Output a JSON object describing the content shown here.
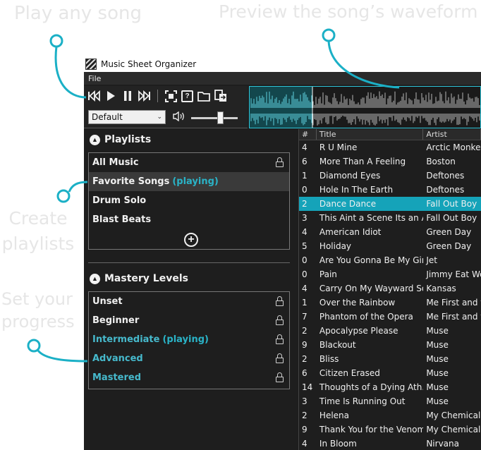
{
  "callouts": {
    "play": "Play any song",
    "preview": "Preview the song’s waveform",
    "create_line1": "Create",
    "create_line2": "playlists",
    "progress_line1": "Set your",
    "progress_line2": "progress"
  },
  "window": {
    "title": "Music Sheet Organizer",
    "menu": [
      "File"
    ]
  },
  "toolbar": {
    "buttons": [
      "previous-icon",
      "play-icon",
      "pause-icon",
      "next-icon",
      "focus-icon",
      "help-icon",
      "folder-icon",
      "export-icon"
    ],
    "mode_value": "Default",
    "volume_level": 0.62
  },
  "waveform": {
    "played_fraction": 0.27
  },
  "playlists": {
    "header": "Playlists",
    "items": [
      {
        "label": "All Music",
        "playing": "",
        "locked": true
      },
      {
        "label": "Favorite Songs",
        "playing": "(playing)",
        "locked": false
      },
      {
        "label": "Drum Solo",
        "playing": "",
        "locked": false
      },
      {
        "label": "Blast Beats",
        "playing": "",
        "locked": false
      }
    ]
  },
  "mastery": {
    "header": "Mastery Levels",
    "items": [
      {
        "label": "Unset",
        "playing": "",
        "locked": true
      },
      {
        "label": "Beginner",
        "playing": "",
        "locked": true
      },
      {
        "label": "Intermediate",
        "playing": "(playing)",
        "locked": true
      },
      {
        "label": "Advanced",
        "playing": "",
        "locked": true
      },
      {
        "label": "Mastered",
        "playing": "",
        "locked": true
      }
    ]
  },
  "songs": {
    "columns": [
      "#",
      "Title",
      "Artist"
    ],
    "rows": [
      [
        "4",
        "R U Mine",
        "Arctic Monkeys"
      ],
      [
        "6",
        "More Than A Feeling",
        "Boston"
      ],
      [
        "1",
        "Diamond Eyes",
        "Deftones"
      ],
      [
        "0",
        "Hole In The Earth",
        "Deftones"
      ],
      [
        "2",
        "Dance Dance",
        "Fall Out Boy"
      ],
      [
        "3",
        "This Aint a Scene Its an A...",
        "Fall Out Boy"
      ],
      [
        "4",
        "American Idiot",
        "Green Day"
      ],
      [
        "5",
        "Holiday",
        "Green Day"
      ],
      [
        "0",
        "Are You Gonna Be My Girl",
        "Jet"
      ],
      [
        "0",
        "Pain",
        "Jimmy Eat World"
      ],
      [
        "4",
        "Carry On My Wayward Son",
        "Kansas"
      ],
      [
        "1",
        "Over the Rainbow",
        "Me First and the"
      ],
      [
        "7",
        "Phantom of the Opera",
        "Me First and the"
      ],
      [
        "2",
        "Apocalypse Please",
        "Muse"
      ],
      [
        "9",
        "Blackout",
        "Muse"
      ],
      [
        "2",
        "Bliss",
        "Muse"
      ],
      [
        "6",
        "Citizen Erased",
        "Muse"
      ],
      [
        "14",
        "Thoughts of a Dying Ath...",
        "Muse"
      ],
      [
        "3",
        "Time Is Running Out",
        "Muse"
      ],
      [
        "2",
        "Helena",
        "My Chemical Romance"
      ],
      [
        "9",
        "Thank You for the Venom",
        "My Chemical Romance"
      ],
      [
        "4",
        "In Bloom",
        "Nirvana"
      ]
    ],
    "active_row": 4
  },
  "colors": {
    "accent": "#15a3b9",
    "callout_line": "#1bb0c6",
    "window_bg": "#1e1e1e"
  }
}
